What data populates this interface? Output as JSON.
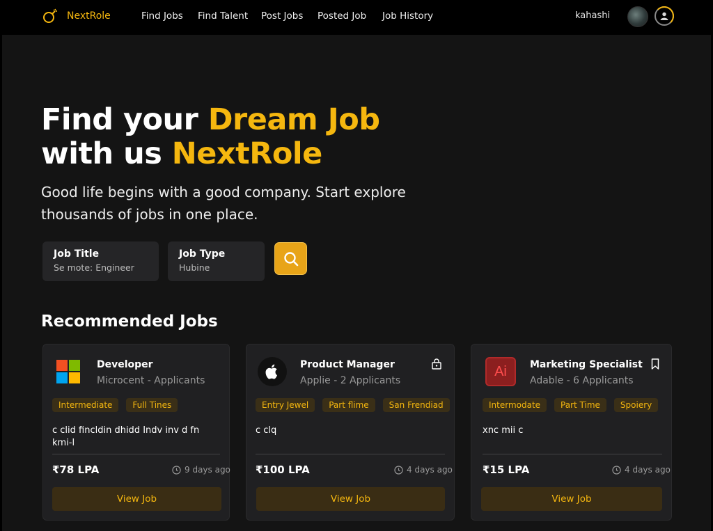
{
  "nav": {
    "brand": "NextRole",
    "links": [
      "Find Jobs",
      "Find Talent",
      "Post Jobs",
      "Posted Job",
      "Job History"
    ],
    "username": "kahashi"
  },
  "hero": {
    "title_part1": "Find your ",
    "title_accent1": "Dream Job",
    "title_part2": "with us ",
    "title_accent2": "NextRole",
    "subtitle": "Good life begins with a good company. Start explore thousands of jobs in one place."
  },
  "search": {
    "job_title_label": "Job Title",
    "job_title_placeholder": "Se mote: Engineer",
    "job_type_label": "Job Type",
    "job_type_placeholder": "Hubine"
  },
  "section_title": "Recommended Jobs",
  "jobs": [
    {
      "title": "Developer",
      "company": "Microcent - Applicants",
      "tags": [
        "Intermediate",
        "Full Tines"
      ],
      "description": "c clid fincldin dhidd Indv inv d fn kmi-l",
      "salary": "₹78 LPA",
      "posted": "9 days ago",
      "button": "View Job",
      "logo_icon": "microsoft-logo-icon"
    },
    {
      "title": "Product Manager",
      "company": "Applie - 2 Applicants",
      "tags": [
        "Entry Jewel",
        "Part flime",
        "San Frendiad"
      ],
      "description": "c clq",
      "salary": "₹100 LPA",
      "posted": "4 days ago",
      "button": "View Job",
      "logo_icon": "apple-logo-icon"
    },
    {
      "title": "Marketing Specialist",
      "company": "Adable - 6 Applicants",
      "tags": [
        "Intermodate",
        "Part Time",
        "Spoiery"
      ],
      "description": "xnc mii c",
      "salary": "₹15 LPA",
      "posted": "4 days ago",
      "button": "View Job",
      "logo_icon": "adobe-illustrator-logo-icon",
      "logo_text": "Ai"
    }
  ],
  "colors": {
    "accent": "#f5b70f",
    "background": "#141414",
    "card": "#202022",
    "nav": "#000000"
  }
}
